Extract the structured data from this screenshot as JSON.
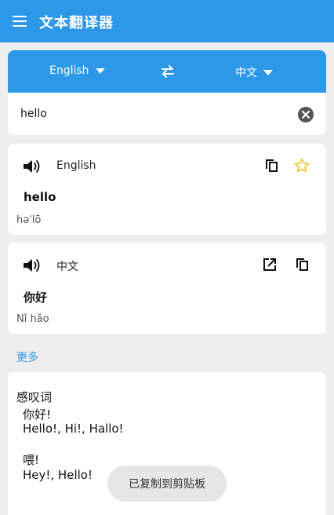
{
  "app_bar": {
    "title": "文本翻译器"
  },
  "languages": {
    "source": "English",
    "target": "中文"
  },
  "input": {
    "value": "hello",
    "placeholder": ""
  },
  "source_card": {
    "language": "English",
    "word": "hello",
    "phonetic": "həˈlō"
  },
  "target_card": {
    "language": "中文",
    "word": "你好",
    "phonetic": "Nǐ hǎo"
  },
  "more": {
    "link": "更多",
    "part_of_speech": "感叹词",
    "entries": [
      {
        "term": "你好!",
        "translations": "Hello!,  Hi!,  Hallo!"
      },
      {
        "term": "喂!",
        "translations": "Hey!,  Hello!"
      }
    ]
  },
  "toast": {
    "message": "已复制到剪贴板"
  },
  "colors": {
    "accent": "#2d97e8",
    "star": "#f2c230",
    "background": "#eeeeee"
  }
}
